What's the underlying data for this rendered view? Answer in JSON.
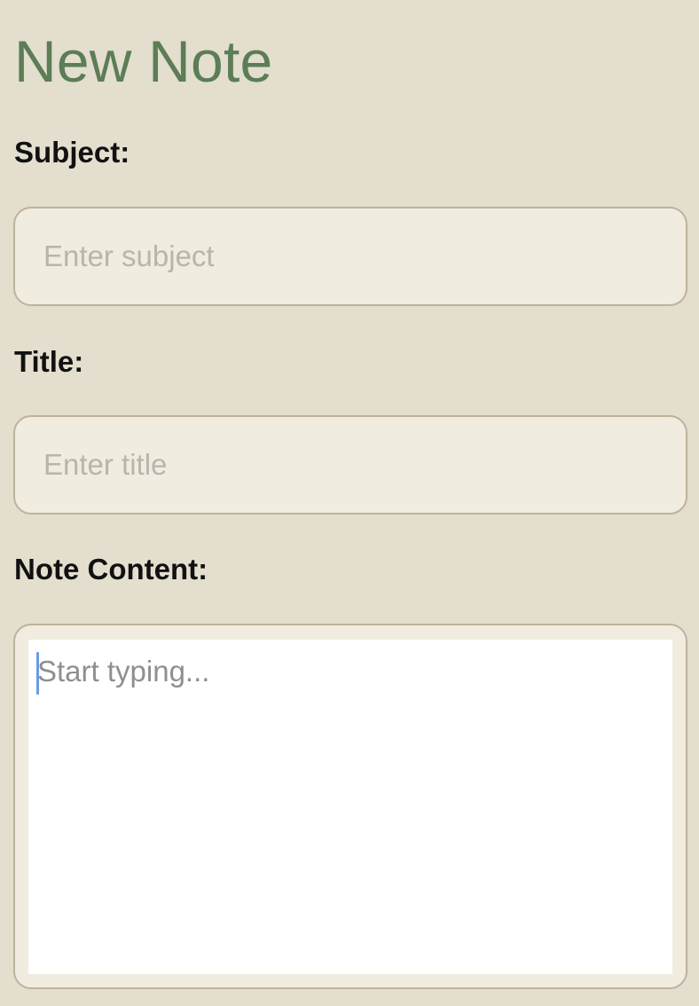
{
  "page": {
    "title": "New Note"
  },
  "form": {
    "subject": {
      "label": "Subject:",
      "value": "",
      "placeholder": "Enter subject"
    },
    "title": {
      "label": "Title:",
      "value": "",
      "placeholder": "Enter title"
    },
    "content": {
      "label": "Note Content:",
      "value": "",
      "placeholder": "Start typing..."
    }
  },
  "colors": {
    "background": "#e3dece",
    "title_green": "#5c7d56",
    "input_fill": "#f0ece0",
    "input_border": "#bfb29b",
    "cursor_blue": "#6a9be3"
  }
}
